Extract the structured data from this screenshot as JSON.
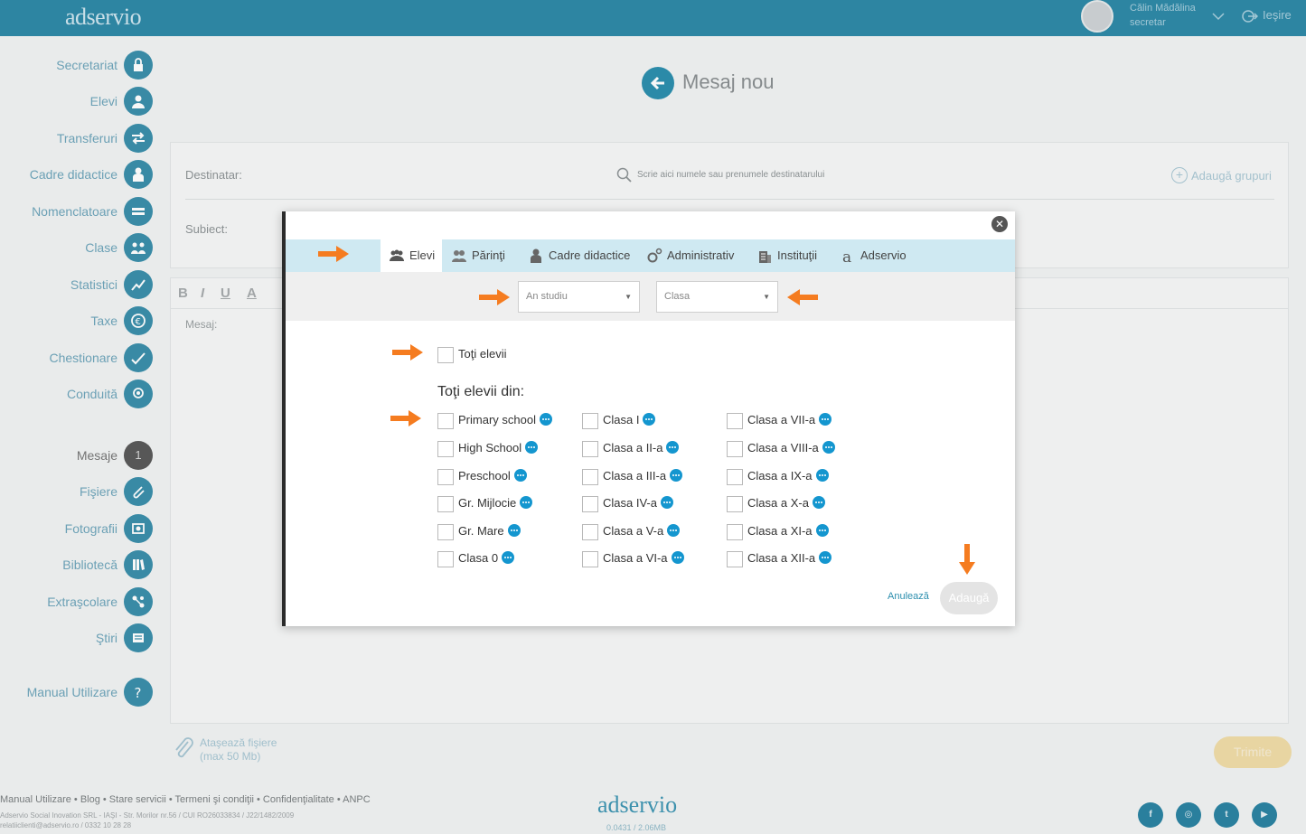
{
  "header": {
    "logo": "adservio",
    "user_name": "Călin Mădălina",
    "user_role": "secretar",
    "logout_label": "Ieşire"
  },
  "sidebar": {
    "items": [
      {
        "label": "Secretariat",
        "icon": "lock-icon"
      },
      {
        "label": "Elevi",
        "icon": "student-icon"
      },
      {
        "label": "Transferuri",
        "icon": "transfer-icon"
      },
      {
        "label": "Cadre didactice",
        "icon": "teacher-icon"
      },
      {
        "label": "Nomenclatoare",
        "icon": "list-icon"
      },
      {
        "label": "Clase",
        "icon": "group-icon"
      },
      {
        "label": "Statistici",
        "icon": "chart-icon"
      },
      {
        "label": "Taxe",
        "icon": "euro-icon"
      },
      {
        "label": "Chestionare",
        "icon": "survey-icon"
      },
      {
        "label": "Conduită",
        "icon": "badge-icon"
      },
      {
        "label": "Mesaje",
        "icon": "count-badge",
        "count": "1"
      },
      {
        "label": "Fişiere",
        "icon": "paperclip-icon"
      },
      {
        "label": "Fotografii",
        "icon": "photo-icon"
      },
      {
        "label": "Bibliotecă",
        "icon": "books-icon"
      },
      {
        "label": "Extraşcolare",
        "icon": "activities-icon"
      },
      {
        "label": "Ştiri",
        "icon": "news-icon"
      },
      {
        "label": "Manual Utilizare",
        "icon": "help-icon"
      }
    ]
  },
  "page": {
    "title": "Mesaj nou",
    "recipient_label": "Destinatar:",
    "recipient_placeholder": "Scrie aici numele sau prenumele destinatarului",
    "add_groups_label": "Adaugă grupuri",
    "subject_label": "Subiect:",
    "message_placeholder": "Mesaj:",
    "toolbar": [
      "B",
      "I",
      "U",
      "A"
    ],
    "attach_label": "Ataşează fişiere",
    "attach_limit": "(max 50 Mb)",
    "send_label": "Trimite"
  },
  "modal": {
    "tabs": [
      {
        "label": "Elevi",
        "icon": "students-icon",
        "active": true
      },
      {
        "label": "Părinţi",
        "icon": "parents-icon",
        "active": false
      },
      {
        "label": "Cadre didactice",
        "icon": "teacher-icon",
        "active": false
      },
      {
        "label": "Administrativ",
        "icon": "gears-icon",
        "active": false
      },
      {
        "label": "Instituţii",
        "icon": "building-icon",
        "active": false
      },
      {
        "label": "Adservio",
        "icon": "adservio-icon",
        "active": false
      }
    ],
    "filters": {
      "year_placeholder": "An studiu",
      "class_placeholder": "Clasa"
    },
    "all_students_label": "Toţi elevii",
    "section_title": "Toţi elevii din:",
    "groups": [
      [
        "Primary school",
        "High School",
        "Preschool",
        "Gr. Mijlocie",
        "Gr. Mare",
        "Clasa 0"
      ],
      [
        "Clasa I",
        "Clasa a II-a",
        "Clasa a III-a",
        "Clasa IV-a",
        "Clasa a V-a",
        "Clasa a VI-a"
      ],
      [
        "Clasa a VII-a",
        "Clasa a VIII-a",
        "Clasa a IX-a",
        "Clasa a X-a",
        "Clasa a XI-a",
        "Clasa a XII-a"
      ]
    ],
    "cancel_label": "Anulează",
    "add_label": "Adaugă"
  },
  "footer": {
    "links": "Manual Utilizare • Blog • Stare servicii • Termeni şi condiţii • Confidenţialitate • ANPC",
    "address": "Adservio Social Inovation SRL - IAŞI - Str. Morilor nr.56 / CUI RO26033834 / J22/1482/2009",
    "contact": "relatiiclienti@adservio.ro / 0332 10 28 28",
    "logo": "adservio",
    "version": "0.0431 / 2.06MB",
    "social": [
      "facebook-icon",
      "instagram-icon",
      "twitter-icon",
      "youtube-icon"
    ]
  },
  "colors": {
    "brand": "#2f8aa8",
    "accent_arrow": "#f57c20",
    "info_dot": "#1496cf",
    "tab_bar": "#cfe9f2"
  }
}
